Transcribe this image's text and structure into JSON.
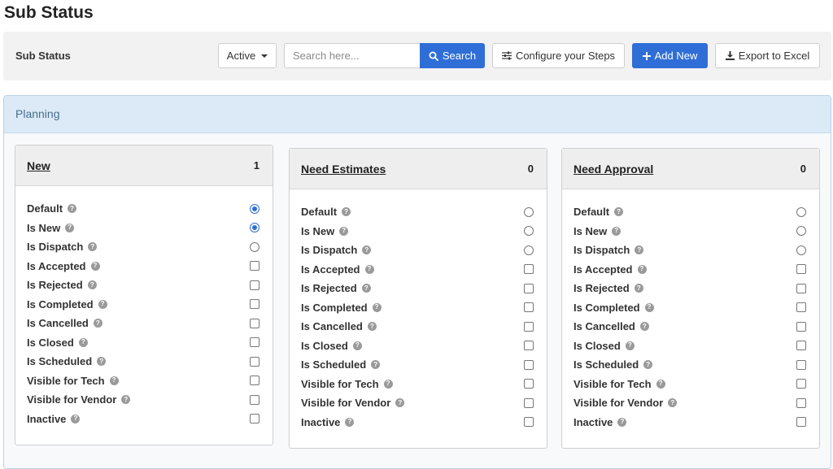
{
  "page": {
    "title": "Sub Status"
  },
  "toolbar": {
    "label": "Sub Status",
    "status_filter": "Active",
    "search_placeholder": "Search here...",
    "search_label": "Search",
    "configure_label": "Configure your Steps",
    "add_label": "Add New",
    "export_label": "Export to Excel"
  },
  "section": {
    "title": "Planning"
  },
  "cards": [
    {
      "title": "New",
      "count": "1",
      "rows": [
        {
          "label": "Default",
          "type": "radio",
          "checked": true
        },
        {
          "label": "Is New",
          "type": "radio",
          "checked": true
        },
        {
          "label": "Is Dispatch",
          "type": "radio",
          "checked": false
        },
        {
          "label": "Is Accepted",
          "type": "checkbox",
          "checked": false
        },
        {
          "label": "Is Rejected",
          "type": "checkbox",
          "checked": false
        },
        {
          "label": "Is Completed",
          "type": "checkbox",
          "checked": false
        },
        {
          "label": "Is Cancelled",
          "type": "checkbox",
          "checked": false
        },
        {
          "label": "Is Closed",
          "type": "checkbox",
          "checked": false
        },
        {
          "label": "Is Scheduled",
          "type": "checkbox",
          "checked": false
        },
        {
          "label": "Visible for Tech",
          "type": "checkbox",
          "checked": false
        },
        {
          "label": "Visible for Vendor",
          "type": "checkbox",
          "checked": false
        },
        {
          "label": "Inactive",
          "type": "checkbox",
          "checked": false
        }
      ]
    },
    {
      "title": "Need Estimates",
      "count": "0",
      "rows": [
        {
          "label": "Default",
          "type": "radio",
          "checked": false
        },
        {
          "label": "Is New",
          "type": "radio",
          "checked": false
        },
        {
          "label": "Is Dispatch",
          "type": "radio",
          "checked": false
        },
        {
          "label": "Is Accepted",
          "type": "checkbox",
          "checked": false
        },
        {
          "label": "Is Rejected",
          "type": "checkbox",
          "checked": false
        },
        {
          "label": "Is Completed",
          "type": "checkbox",
          "checked": false
        },
        {
          "label": "Is Cancelled",
          "type": "checkbox",
          "checked": false
        },
        {
          "label": "Is Closed",
          "type": "checkbox",
          "checked": false
        },
        {
          "label": "Is Scheduled",
          "type": "checkbox",
          "checked": false
        },
        {
          "label": "Visible for Tech",
          "type": "checkbox",
          "checked": false
        },
        {
          "label": "Visible for Vendor",
          "type": "checkbox",
          "checked": false
        },
        {
          "label": "Inactive",
          "type": "checkbox",
          "checked": false
        }
      ]
    },
    {
      "title": "Need Approval",
      "count": "0",
      "rows": [
        {
          "label": "Default",
          "type": "radio",
          "checked": false
        },
        {
          "label": "Is New",
          "type": "radio",
          "checked": false
        },
        {
          "label": "Is Dispatch",
          "type": "radio",
          "checked": false
        },
        {
          "label": "Is Accepted",
          "type": "checkbox",
          "checked": false
        },
        {
          "label": "Is Rejected",
          "type": "checkbox",
          "checked": false
        },
        {
          "label": "Is Completed",
          "type": "checkbox",
          "checked": false
        },
        {
          "label": "Is Cancelled",
          "type": "checkbox",
          "checked": false
        },
        {
          "label": "Is Closed",
          "type": "checkbox",
          "checked": false
        },
        {
          "label": "Is Scheduled",
          "type": "checkbox",
          "checked": false
        },
        {
          "label": "Visible for Tech",
          "type": "checkbox",
          "checked": false
        },
        {
          "label": "Visible for Vendor",
          "type": "checkbox",
          "checked": false
        },
        {
          "label": "Inactive",
          "type": "checkbox",
          "checked": false
        }
      ]
    }
  ],
  "icons": {
    "search": "search-icon",
    "configure": "sliders-icon",
    "add": "plus-icon",
    "export": "download-icon",
    "help": "question-circle-icon",
    "status_caret": "caret-down-icon"
  },
  "colors": {
    "primary": "#2f6ed6",
    "section_header": "#dbeaf6",
    "help_icon": "#9a9a9a"
  }
}
